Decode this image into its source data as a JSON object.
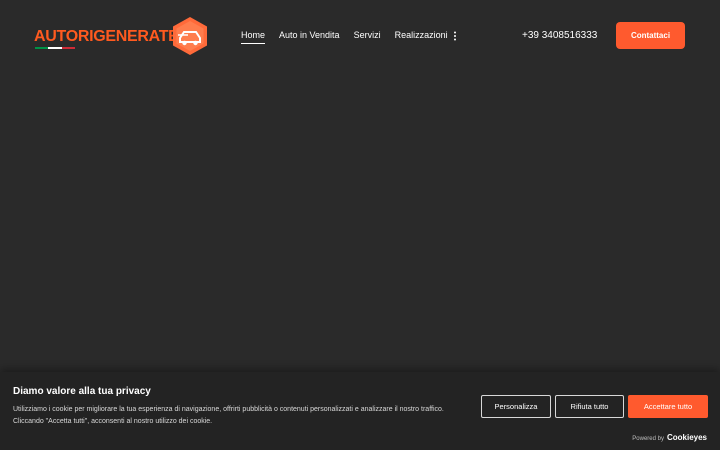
{
  "header": {
    "logo_text": "AUTORIGENERATE.IT",
    "nav": [
      {
        "label": "Home",
        "active": true
      },
      {
        "label": "Auto in Vendita",
        "active": false
      },
      {
        "label": "Servizi",
        "active": false
      },
      {
        "label": "Realizzazioni",
        "active": false
      }
    ],
    "phone": "+39 3408516333",
    "cta_label": "Contattaci"
  },
  "cookie_banner": {
    "title": "Diamo valore alla tua privacy",
    "description": "Utilizziamo i cookie per migliorare la tua esperienza di navigazione, offrirti pubblicità o contenuti personalizzati e analizzare il nostro traffico. Cliccando \"Accetta tutti\", acconsenti al nostro utilizzo dei cookie.",
    "buttons": {
      "customize": "Personalizza",
      "reject": "Rifiuta tutto",
      "accept": "Accettare tutto"
    },
    "powered_by_label": "Powered by",
    "powered_by_brand": "Cookieyes"
  },
  "icons": {
    "more": "more-vertical-icon",
    "logo_mark": "hexagon-car-logo-icon"
  },
  "colors": {
    "background": "#2a2a2a",
    "accent": "#ff5a2e",
    "banner": "#232323",
    "text": "#ffffff",
    "flag_green": "#009246",
    "flag_white": "#ffffff",
    "flag_red": "#ce2b37"
  }
}
